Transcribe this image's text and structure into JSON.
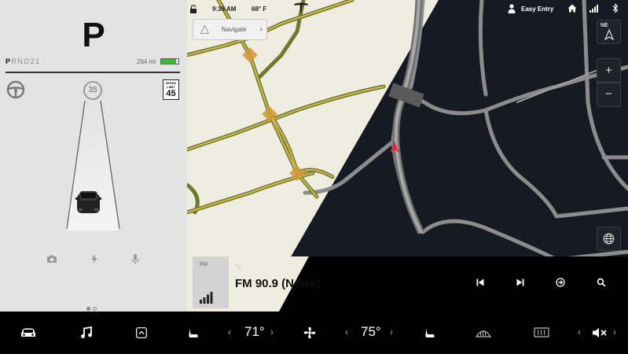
{
  "cluster": {
    "gear": "P",
    "gear_options": [
      "P",
      "R",
      "N",
      "D",
      "2",
      "1"
    ],
    "gear_selected_index": 0,
    "range": "264 mi",
    "battery_level": 0.85,
    "set_speed": "35",
    "speed_limit_label": "SPEED LIMIT",
    "speed_limit_value": "45",
    "page_count": 2,
    "page_active": 0,
    "icons": [
      "steering-wheel-icon",
      "car-icon",
      "camera-icon",
      "lightning-icon",
      "microphone-icon"
    ]
  },
  "status_bar": {
    "time": "9:38 AM",
    "temperature": "68° F",
    "profile": "Easy Entry",
    "icons": [
      "lock-icon",
      "tesla-logo",
      "profile-icon",
      "home-icon",
      "signal-icon",
      "bluetooth-icon"
    ]
  },
  "navigate": {
    "label": "Navigate",
    "icons": [
      "navigate-arrow-icon",
      "chevron-right-icon"
    ]
  },
  "map_controls": {
    "compass_label": "N",
    "compass_direction": "NE",
    "zoom_in": "+",
    "zoom_out": "−",
    "icons": [
      "compass-icon",
      "globe-icon"
    ]
  },
  "media": {
    "source": "FM",
    "station": "FM 90.9 (News)",
    "icons": [
      "heart-icon",
      "signal-bars-icon",
      "previous-track-icon",
      "next-track-icon",
      "source-switch-icon",
      "search-icon"
    ]
  },
  "climate": {
    "driver_temp": "71°",
    "passenger_temp": "75°",
    "icons": [
      "car-icon",
      "music-icon",
      "app-launcher-icon",
      "seat-heater-icon",
      "fan-icon",
      "rear-defrost-icon",
      "front-defrost-icon",
      "mute-icon",
      "chevron-left-icon",
      "chevron-right-icon"
    ]
  },
  "colors": {
    "cluster_bg": "#e3e3e3",
    "map_light": "#efeddf",
    "map_dark": "#161a22",
    "road_major": "#bfa347",
    "road_dark": "#8c8c8c",
    "battery": "#33bb33",
    "nav_marker": "#e8262d"
  }
}
